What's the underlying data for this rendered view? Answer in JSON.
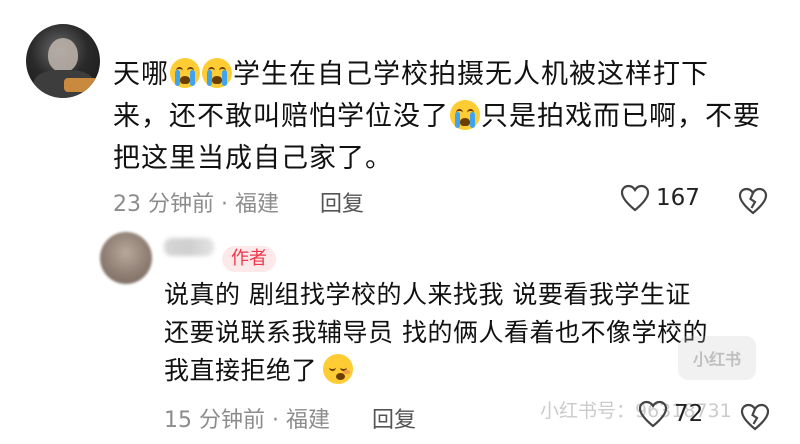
{
  "comment": {
    "text_part1": "天哪",
    "text_part2": "学生在自己学校拍摄无人机被这样打下来，还不敢叫赔怕学位没了",
    "text_part3": "只是拍戏而已啊，不要把这里当成自己家了。",
    "time": "23 分钟前 · 福建",
    "reply_label": "回复",
    "like_count": "167",
    "emoji_icon": "loudly-crying-face"
  },
  "reply": {
    "author_badge": "作者",
    "line1": "说真的 剧组找学校的人来找我 说要看我学生证",
    "line2": "还要说联系我辅导员 找的俩人看着也不像学校的",
    "line3": "我直接拒绝了",
    "emoji_icon": "tired-face",
    "time": "15 分钟前 · 福建",
    "reply_label": "回复",
    "like_count": "72"
  },
  "watermark": {
    "text": "小红书号：96318731",
    "logo": "小红书"
  },
  "colors": {
    "accent": "#f0374a",
    "badge_bg": "#fde8ea",
    "meta_gray": "#8c8c8c"
  }
}
